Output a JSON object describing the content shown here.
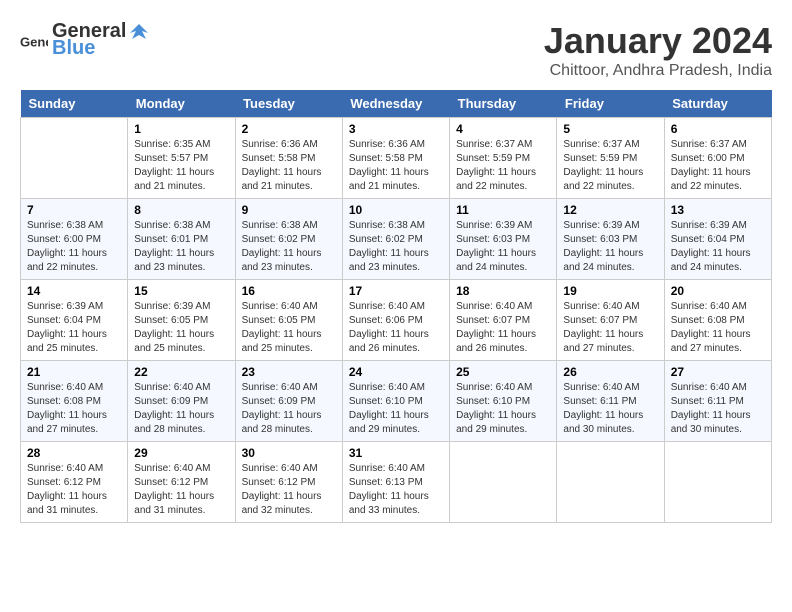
{
  "logo": {
    "text_general": "General",
    "text_blue": "Blue"
  },
  "title": "January 2024",
  "subtitle": "Chittoor, Andhra Pradesh, India",
  "days_of_week": [
    "Sunday",
    "Monday",
    "Tuesday",
    "Wednesday",
    "Thursday",
    "Friday",
    "Saturday"
  ],
  "weeks": [
    [
      {
        "day": "",
        "sunrise": "",
        "sunset": "",
        "daylight": ""
      },
      {
        "day": "1",
        "sunrise": "Sunrise: 6:35 AM",
        "sunset": "Sunset: 5:57 PM",
        "daylight": "Daylight: 11 hours and 21 minutes."
      },
      {
        "day": "2",
        "sunrise": "Sunrise: 6:36 AM",
        "sunset": "Sunset: 5:58 PM",
        "daylight": "Daylight: 11 hours and 21 minutes."
      },
      {
        "day": "3",
        "sunrise": "Sunrise: 6:36 AM",
        "sunset": "Sunset: 5:58 PM",
        "daylight": "Daylight: 11 hours and 21 minutes."
      },
      {
        "day": "4",
        "sunrise": "Sunrise: 6:37 AM",
        "sunset": "Sunset: 5:59 PM",
        "daylight": "Daylight: 11 hours and 22 minutes."
      },
      {
        "day": "5",
        "sunrise": "Sunrise: 6:37 AM",
        "sunset": "Sunset: 5:59 PM",
        "daylight": "Daylight: 11 hours and 22 minutes."
      },
      {
        "day": "6",
        "sunrise": "Sunrise: 6:37 AM",
        "sunset": "Sunset: 6:00 PM",
        "daylight": "Daylight: 11 hours and 22 minutes."
      }
    ],
    [
      {
        "day": "7",
        "sunrise": "Sunrise: 6:38 AM",
        "sunset": "Sunset: 6:00 PM",
        "daylight": "Daylight: 11 hours and 22 minutes."
      },
      {
        "day": "8",
        "sunrise": "Sunrise: 6:38 AM",
        "sunset": "Sunset: 6:01 PM",
        "daylight": "Daylight: 11 hours and 23 minutes."
      },
      {
        "day": "9",
        "sunrise": "Sunrise: 6:38 AM",
        "sunset": "Sunset: 6:02 PM",
        "daylight": "Daylight: 11 hours and 23 minutes."
      },
      {
        "day": "10",
        "sunrise": "Sunrise: 6:38 AM",
        "sunset": "Sunset: 6:02 PM",
        "daylight": "Daylight: 11 hours and 23 minutes."
      },
      {
        "day": "11",
        "sunrise": "Sunrise: 6:39 AM",
        "sunset": "Sunset: 6:03 PM",
        "daylight": "Daylight: 11 hours and 24 minutes."
      },
      {
        "day": "12",
        "sunrise": "Sunrise: 6:39 AM",
        "sunset": "Sunset: 6:03 PM",
        "daylight": "Daylight: 11 hours and 24 minutes."
      },
      {
        "day": "13",
        "sunrise": "Sunrise: 6:39 AM",
        "sunset": "Sunset: 6:04 PM",
        "daylight": "Daylight: 11 hours and 24 minutes."
      }
    ],
    [
      {
        "day": "14",
        "sunrise": "Sunrise: 6:39 AM",
        "sunset": "Sunset: 6:04 PM",
        "daylight": "Daylight: 11 hours and 25 minutes."
      },
      {
        "day": "15",
        "sunrise": "Sunrise: 6:39 AM",
        "sunset": "Sunset: 6:05 PM",
        "daylight": "Daylight: 11 hours and 25 minutes."
      },
      {
        "day": "16",
        "sunrise": "Sunrise: 6:40 AM",
        "sunset": "Sunset: 6:05 PM",
        "daylight": "Daylight: 11 hours and 25 minutes."
      },
      {
        "day": "17",
        "sunrise": "Sunrise: 6:40 AM",
        "sunset": "Sunset: 6:06 PM",
        "daylight": "Daylight: 11 hours and 26 minutes."
      },
      {
        "day": "18",
        "sunrise": "Sunrise: 6:40 AM",
        "sunset": "Sunset: 6:07 PM",
        "daylight": "Daylight: 11 hours and 26 minutes."
      },
      {
        "day": "19",
        "sunrise": "Sunrise: 6:40 AM",
        "sunset": "Sunset: 6:07 PM",
        "daylight": "Daylight: 11 hours and 27 minutes."
      },
      {
        "day": "20",
        "sunrise": "Sunrise: 6:40 AM",
        "sunset": "Sunset: 6:08 PM",
        "daylight": "Daylight: 11 hours and 27 minutes."
      }
    ],
    [
      {
        "day": "21",
        "sunrise": "Sunrise: 6:40 AM",
        "sunset": "Sunset: 6:08 PM",
        "daylight": "Daylight: 11 hours and 27 minutes."
      },
      {
        "day": "22",
        "sunrise": "Sunrise: 6:40 AM",
        "sunset": "Sunset: 6:09 PM",
        "daylight": "Daylight: 11 hours and 28 minutes."
      },
      {
        "day": "23",
        "sunrise": "Sunrise: 6:40 AM",
        "sunset": "Sunset: 6:09 PM",
        "daylight": "Daylight: 11 hours and 28 minutes."
      },
      {
        "day": "24",
        "sunrise": "Sunrise: 6:40 AM",
        "sunset": "Sunset: 6:10 PM",
        "daylight": "Daylight: 11 hours and 29 minutes."
      },
      {
        "day": "25",
        "sunrise": "Sunrise: 6:40 AM",
        "sunset": "Sunset: 6:10 PM",
        "daylight": "Daylight: 11 hours and 29 minutes."
      },
      {
        "day": "26",
        "sunrise": "Sunrise: 6:40 AM",
        "sunset": "Sunset: 6:11 PM",
        "daylight": "Daylight: 11 hours and 30 minutes."
      },
      {
        "day": "27",
        "sunrise": "Sunrise: 6:40 AM",
        "sunset": "Sunset: 6:11 PM",
        "daylight": "Daylight: 11 hours and 30 minutes."
      }
    ],
    [
      {
        "day": "28",
        "sunrise": "Sunrise: 6:40 AM",
        "sunset": "Sunset: 6:12 PM",
        "daylight": "Daylight: 11 hours and 31 minutes."
      },
      {
        "day": "29",
        "sunrise": "Sunrise: 6:40 AM",
        "sunset": "Sunset: 6:12 PM",
        "daylight": "Daylight: 11 hours and 31 minutes."
      },
      {
        "day": "30",
        "sunrise": "Sunrise: 6:40 AM",
        "sunset": "Sunset: 6:12 PM",
        "daylight": "Daylight: 11 hours and 32 minutes."
      },
      {
        "day": "31",
        "sunrise": "Sunrise: 6:40 AM",
        "sunset": "Sunset: 6:13 PM",
        "daylight": "Daylight: 11 hours and 33 minutes."
      },
      {
        "day": "",
        "sunrise": "",
        "sunset": "",
        "daylight": ""
      },
      {
        "day": "",
        "sunrise": "",
        "sunset": "",
        "daylight": ""
      },
      {
        "day": "",
        "sunrise": "",
        "sunset": "",
        "daylight": ""
      }
    ]
  ]
}
